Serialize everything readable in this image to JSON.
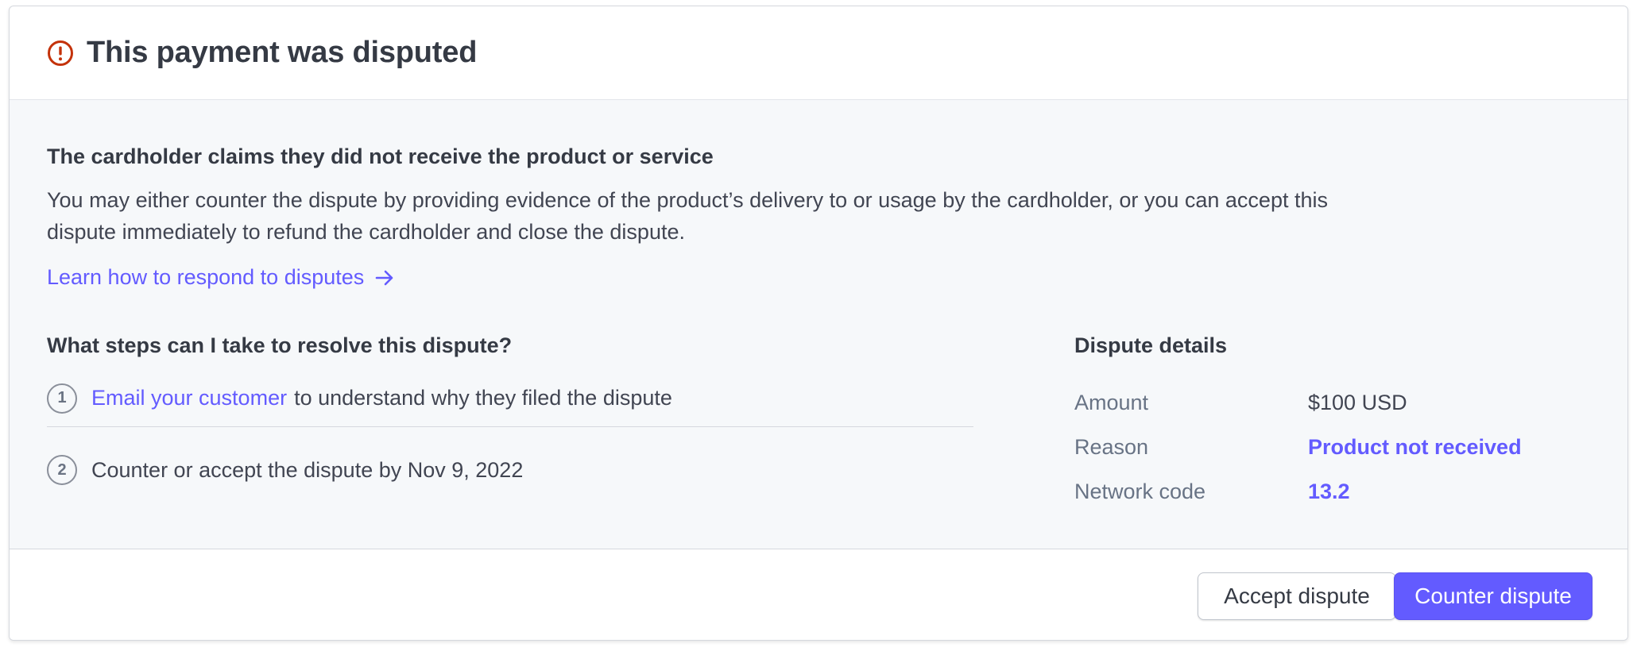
{
  "colors": {
    "accent": "#635bff",
    "warning": "#c4320a",
    "body_bg": "#f6f8fa",
    "text": "#353a44",
    "muted": "#687385"
  },
  "header": {
    "icon": "warning-circle-icon",
    "title": "This payment was disputed"
  },
  "claim": {
    "heading": "The cardholder claims they did not receive the product or service",
    "description": "You may either counter the dispute by providing evidence of the product’s delivery to or usage by the cardholder, or you can accept this dispute immediately to refund the cardholder and close the dispute.",
    "learn_link": "Learn how to respond to disputes",
    "learn_icon": "arrow-right-icon"
  },
  "steps": {
    "heading": "What steps can I take to resolve this dispute?",
    "items": [
      {
        "number": "1",
        "link": "Email your customer",
        "text": "to understand why they filed the dispute"
      },
      {
        "number": "2",
        "text": "Counter or accept the dispute by Nov 9, 2022"
      }
    ]
  },
  "details": {
    "heading": "Dispute details",
    "rows": [
      {
        "label": "Amount",
        "value": "$100 USD"
      },
      {
        "label": "Reason",
        "value": "Product not received"
      },
      {
        "label": "Network code",
        "value": "13.2"
      }
    ]
  },
  "footer": {
    "accept_label": "Accept dispute",
    "counter_label": "Counter dispute"
  }
}
